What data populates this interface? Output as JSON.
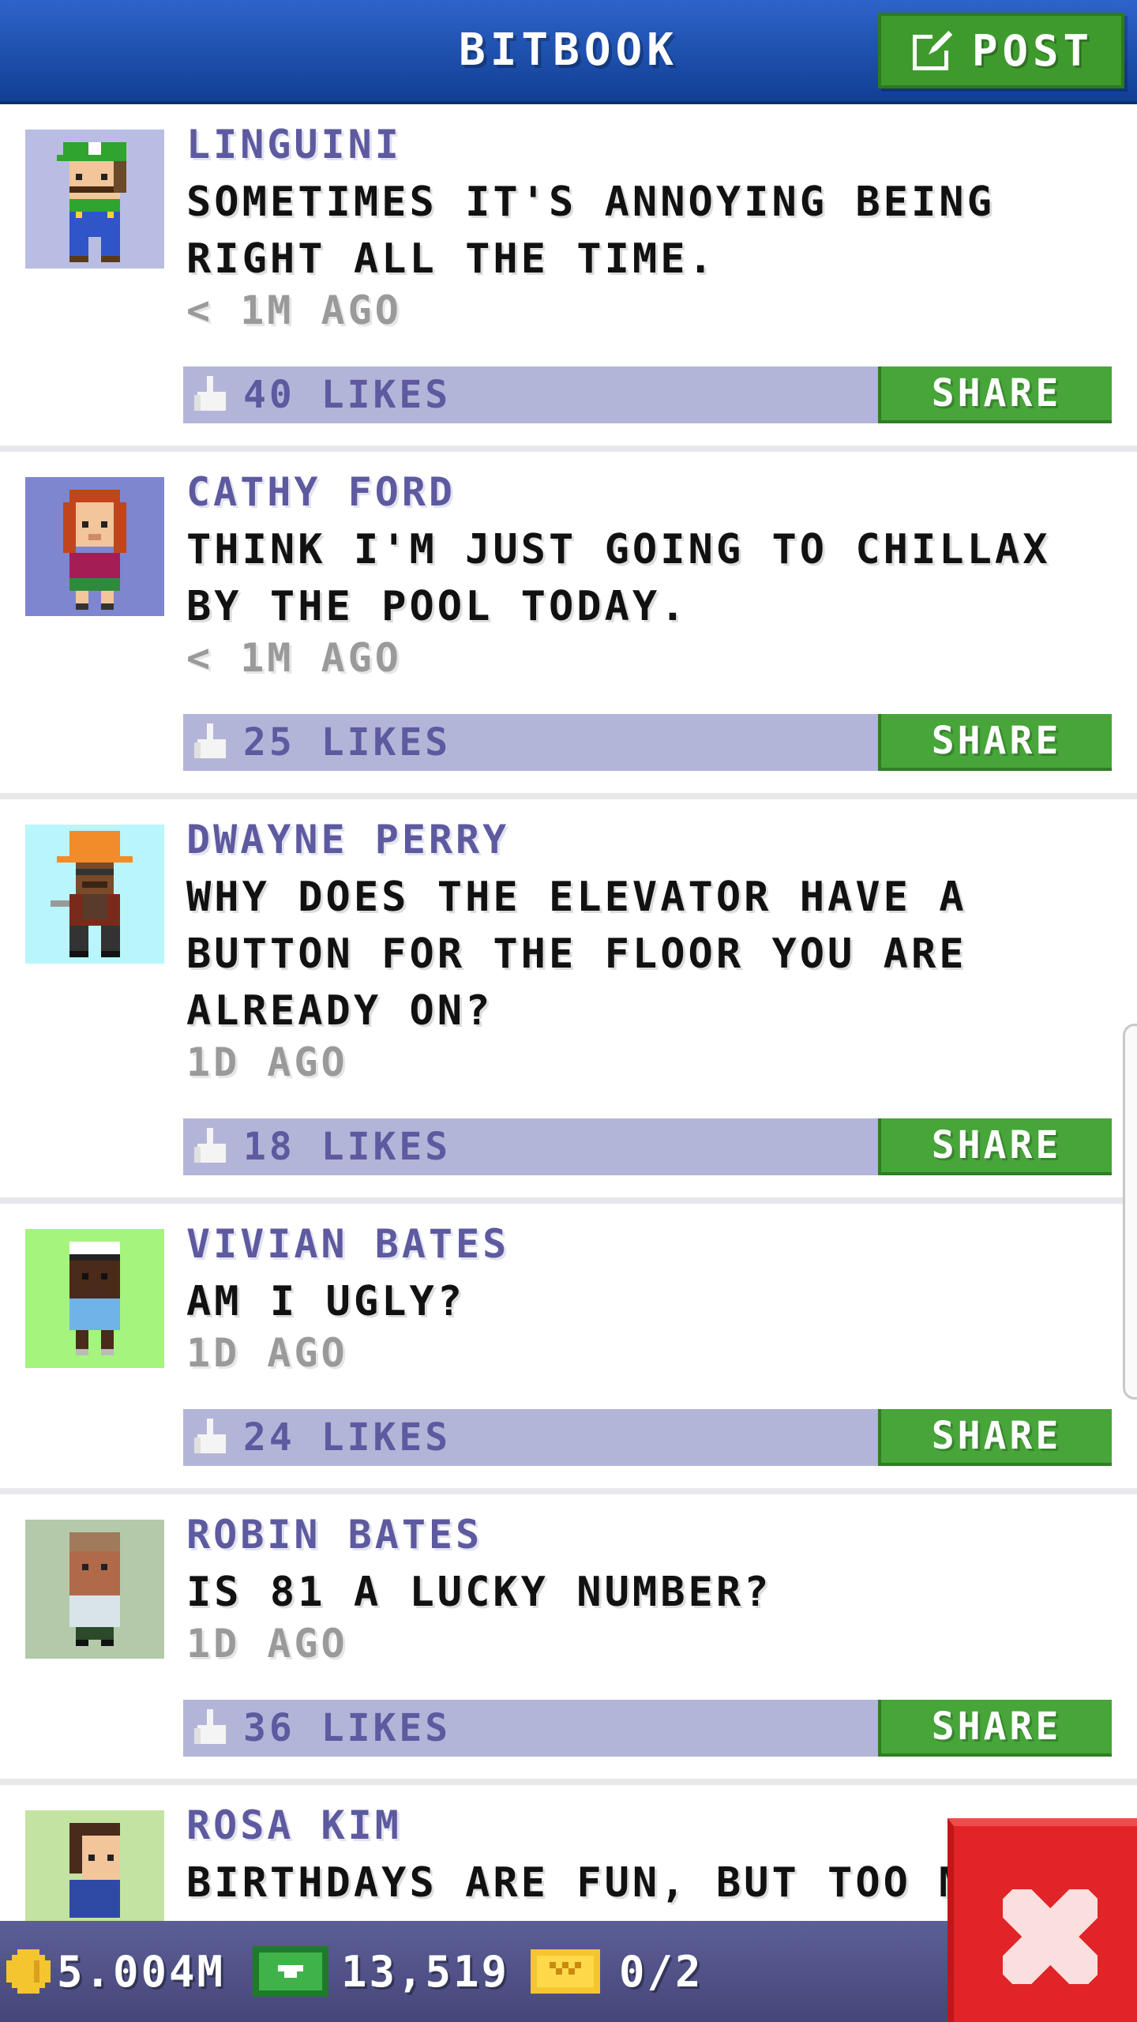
{
  "header": {
    "title": "BITBOOK",
    "post_label": "POST"
  },
  "posts": [
    {
      "author": "LINGUINI",
      "message": "SOMETIMES IT'S ANNOYING BEING RIGHT ALL THE TIME.",
      "time": "< 1M AGO",
      "likes": "40 LIKES",
      "share_label": "SHARE",
      "avatar_bg": "#b9bde3"
    },
    {
      "author": "CATHY FORD",
      "message": "THINK I'M JUST GOING TO CHILLAX BY THE POOL TODAY.",
      "time": "< 1M AGO",
      "likes": "25 LIKES",
      "share_label": "SHARE",
      "avatar_bg": "#7d86cf"
    },
    {
      "author": "DWAYNE PERRY",
      "message": "WHY DOES THE ELEVATOR HAVE A BUTTON FOR THE FLOOR YOU ARE ALREADY ON?",
      "time": "1D AGO",
      "likes": "18 LIKES",
      "share_label": "SHARE",
      "avatar_bg": "#b8f6fb"
    },
    {
      "author": "VIVIAN BATES",
      "message": "AM I UGLY?",
      "time": "1D AGO",
      "likes": "24 LIKES",
      "share_label": "SHARE",
      "avatar_bg": "#a4f47e"
    },
    {
      "author": "ROBIN BATES",
      "message": "IS 81 A LUCKY NUMBER?",
      "time": "1D AGO",
      "likes": "36 LIKES",
      "share_label": "SHARE",
      "avatar_bg": "#b3c9aa"
    },
    {
      "author": "ROSA KIM",
      "message": "BIRTHDAYS ARE FUN, BUT TOO M",
      "avatar_bg": "#c3e3a2"
    }
  ],
  "bottom_bar": {
    "coins": "5.004M",
    "bux": "13,519",
    "tickets": "0/2"
  },
  "colors": {
    "header_blue": "#1d4fb0",
    "accent_green": "#47a53a",
    "likes_bar": "#b3b5d8",
    "author_purple": "#5d5aa0",
    "close_red": "#e02427"
  },
  "icons": {
    "post": "edit-icon",
    "like": "thumbs-up-icon",
    "coin": "coin-icon",
    "bux": "bux-icon",
    "ticket": "ticket-icon",
    "close": "close-icon"
  }
}
